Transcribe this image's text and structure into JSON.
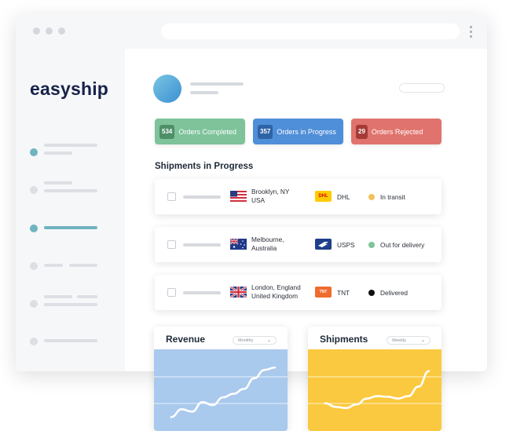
{
  "brand": {
    "logo_text": "easyship"
  },
  "stats": [
    {
      "count": "534",
      "label": "Orders Completed",
      "color": "#7ec39a",
      "count_bg": "#4f8f68"
    },
    {
      "count": "357",
      "label": "Orders in Progress",
      "color": "#4f8ed8",
      "count_bg": "#2f63a6"
    },
    {
      "count": "29",
      "label": "Orders Rejected",
      "color": "#e0736d",
      "count_bg": "#a63b36"
    }
  ],
  "shipments": {
    "title": "Shipments in Progress",
    "rows": [
      {
        "flag": "us-flag",
        "location_line1": "Brooklyn, NY",
        "location_line2": "USA",
        "carrier": "DHL",
        "carrier_logo_text": "DHL",
        "carrier_color": "#ffcc00",
        "carrier_text_color": "#d40511",
        "status": "In transit",
        "status_color": "#f3c15a"
      },
      {
        "flag": "au-flag",
        "location_line1": "Melbourne,",
        "location_line2": "Australia",
        "carrier": "USPS",
        "carrier_logo_text": "USPS",
        "carrier_color": "#1f3f8a",
        "carrier_text_color": "#ffffff",
        "status": "Out for delivery",
        "status_color": "#7ec39a"
      },
      {
        "flag": "uk-flag",
        "location_line1": "London, England",
        "location_line2": "United Kingdom",
        "carrier": "TNT",
        "carrier_logo_text": "TNT",
        "carrier_color": "#ef6c2f",
        "carrier_text_color": "#ffffff",
        "status": "Delivered",
        "status_color": "#111111"
      }
    ]
  },
  "revenue": {
    "title": "Revenue",
    "period": "Monthly",
    "color": "#a9c9ed"
  },
  "shipments_chart": {
    "title": "Shipments",
    "period": "Weekly",
    "color": "#fbc93f"
  },
  "chart_data": [
    {
      "type": "line",
      "title": "Revenue",
      "x": [
        0,
        1,
        2,
        3,
        4,
        5,
        6,
        7,
        8,
        9,
        10
      ],
      "y": [
        5,
        18,
        14,
        30,
        25,
        38,
        44,
        52,
        70,
        84,
        88
      ]
    },
    {
      "type": "line",
      "title": "Shipments",
      "x": [
        0,
        1,
        2,
        3,
        4,
        5,
        6,
        7,
        8,
        9,
        10
      ],
      "y": [
        28,
        22,
        20,
        26,
        36,
        40,
        39,
        36,
        40,
        56,
        82
      ]
    }
  ]
}
